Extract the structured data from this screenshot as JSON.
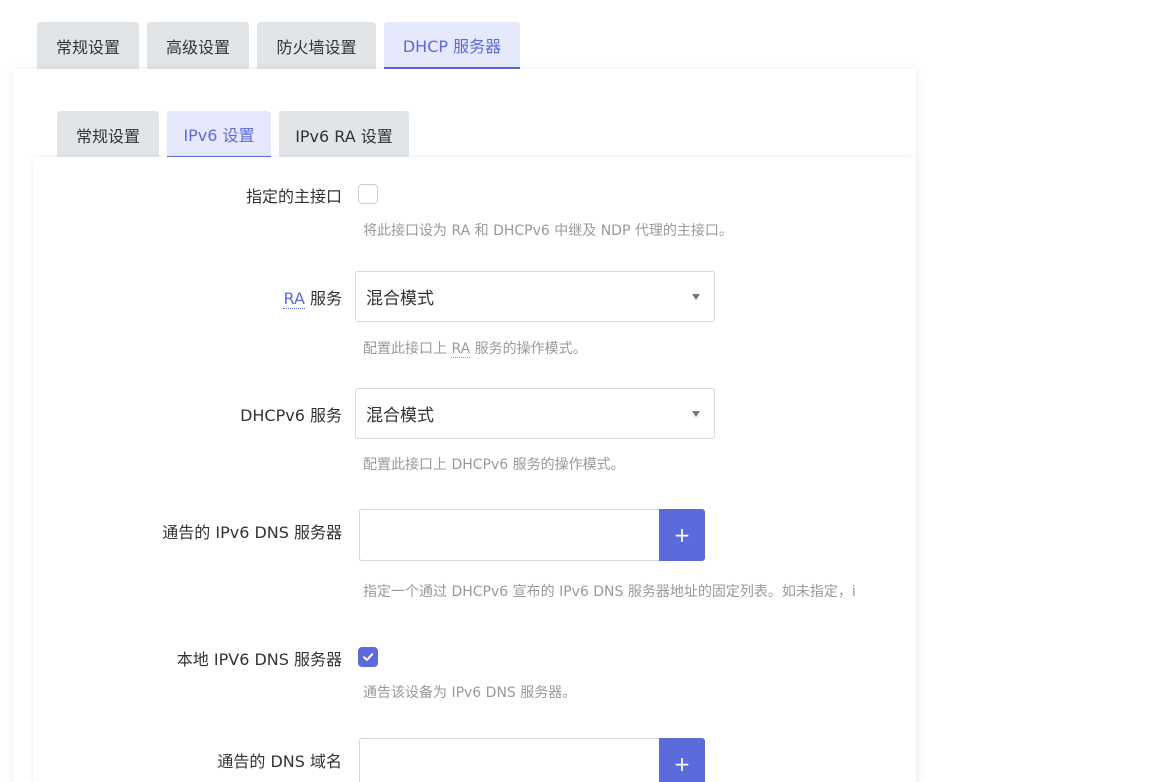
{
  "tabs_top": [
    {
      "label": "常规设置",
      "active": false
    },
    {
      "label": "高级设置",
      "active": false
    },
    {
      "label": "防火墙设置",
      "active": false
    },
    {
      "label": "DHCP 服务器",
      "active": true
    }
  ],
  "tabs_sub": [
    {
      "label": "常规设置",
      "active": false
    },
    {
      "label": "IPv6 设置",
      "active": true
    },
    {
      "label": "IPv6 RA 设置",
      "active": false
    }
  ],
  "form": {
    "master": {
      "label": "指定的主接口",
      "checked": false,
      "help": "将此接口设为 RA 和 DHCPv6 中继及 NDP 代理的主接口。"
    },
    "ra_service": {
      "label_abbr": "RA",
      "label_rest": " 服务",
      "value": "混合模式",
      "help_prefix": "配置此接口上 ",
      "help_abbr": "RA",
      "help_suffix": " 服务的操作模式。"
    },
    "dhcpv6_service": {
      "label": "DHCPv6 服务",
      "value": "混合模式",
      "help": "配置此接口上 DHCPv6 服务的操作模式。"
    },
    "ipv6_dns": {
      "label": "通告的 IPv6 DNS 服务器",
      "value": "",
      "add_label": "+",
      "help": "指定一个通过 DHCPv6 宣布的 IPv6 DNS 服务器地址的固定列表。如未指定，i"
    },
    "local_ipv6_dns": {
      "label": "本地 IPV6 DNS 服务器",
      "checked": true,
      "help": "通告该设备为 IPv6 DNS 服务器。"
    },
    "dns_domain": {
      "label": "通告的 DNS 域名",
      "value": "",
      "add_label": "+"
    }
  },
  "colors": {
    "accent": "#5c6bdc",
    "tab_bg": "#e1e5e8",
    "tab_active_bg": "#e6e9fb",
    "help_text": "#999999"
  }
}
